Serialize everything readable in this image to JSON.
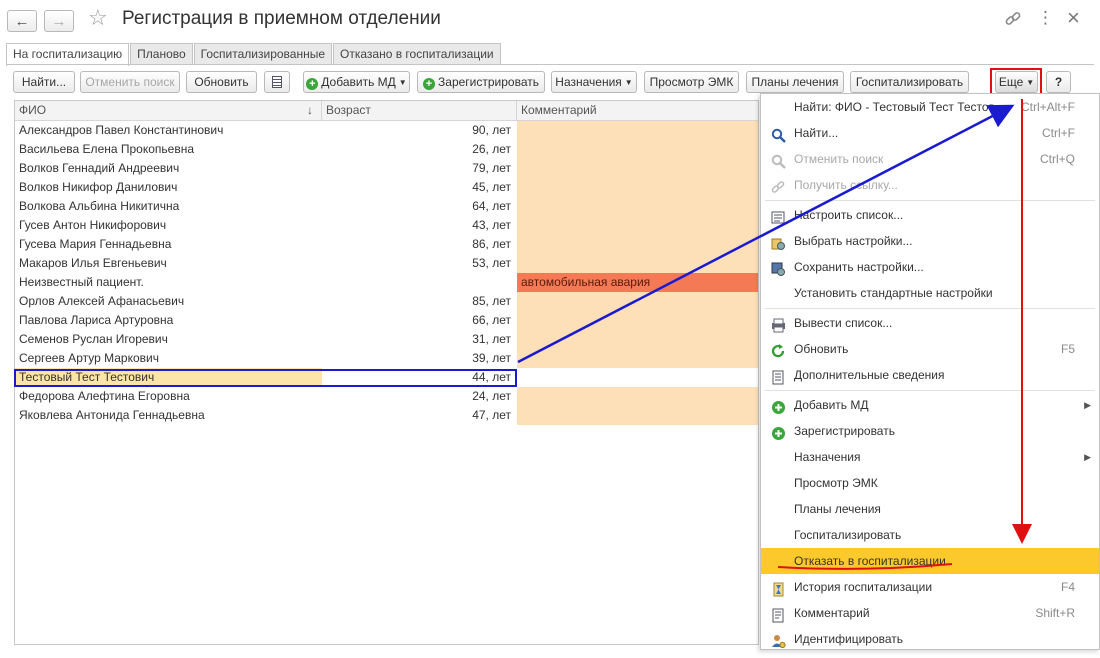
{
  "window": {
    "title": "Регистрация в приемном отделении",
    "back_icon": "←",
    "forward_icon": "→",
    "star_icon": "☆",
    "link_icon": "🔗",
    "more_icon": "⋮",
    "close_icon": "×"
  },
  "tabs": [
    {
      "label": "На госпитализацию",
      "active": true
    },
    {
      "label": "Планово"
    },
    {
      "label": "Госпитализированные"
    },
    {
      "label": "Отказано в госпитализации"
    }
  ],
  "toolbar": {
    "find": "Найти...",
    "cancel_search": "Отменить поиск",
    "refresh": "Обновить",
    "add_md": "Добавить МД",
    "register": "Зарегистрировать",
    "assignments": "Назначения",
    "view_emk": "Просмотр ЭМК",
    "treatment_plans": "Планы лечения",
    "hospitalize": "Госпитализировать",
    "more": "Еще",
    "help": "?"
  },
  "table": {
    "columns": [
      "ФИО",
      "Возраст",
      "Комментарий"
    ],
    "sort_indicator": "↓",
    "rows": [
      {
        "fio": "Александров Павел Константинович",
        "age": "90, лет",
        "comment": ""
      },
      {
        "fio": "Васильева Елена Прокопьевна",
        "age": "26, лет",
        "comment": ""
      },
      {
        "fio": "Волков Геннадий Андреевич",
        "age": "79, лет",
        "comment": ""
      },
      {
        "fio": "Волков Никифор Данилович",
        "age": "45, лет",
        "comment": ""
      },
      {
        "fio": "Волкова Альбина Никитична",
        "age": "64, лет",
        "comment": ""
      },
      {
        "fio": "Гусев Антон Никифорович",
        "age": "43, лет",
        "comment": ""
      },
      {
        "fio": "Гусева Мария Геннадьевна",
        "age": "86, лет",
        "comment": ""
      },
      {
        "fio": "Макаров Илья Евгеньевич",
        "age": "53, лет",
        "comment": ""
      },
      {
        "fio": "Неизвестный пациент.",
        "age": "",
        "comment": "автомобильная авария"
      },
      {
        "fio": "Орлов Алексей Афанасьевич",
        "age": "85, лет",
        "comment": ""
      },
      {
        "fio": "Павлова Лариса Артуровна",
        "age": "66, лет",
        "comment": ""
      },
      {
        "fio": "Семенов Руслан Игоревич",
        "age": "31, лет",
        "comment": ""
      },
      {
        "fio": "Сергеев Артур Маркович",
        "age": "39, лет",
        "comment": ""
      },
      {
        "fio": "Тестовый Тест Тестович",
        "age": "44, лет",
        "comment": "",
        "selected": true
      },
      {
        "fio": "Федорова Алефтина Егоровна",
        "age": "24, лет",
        "comment": ""
      },
      {
        "fio": "Яковлева Антонида Геннадьевна",
        "age": "47, лет",
        "comment": ""
      }
    ]
  },
  "menu": {
    "items": [
      {
        "label": "Найти: ФИО - Тестовый Тест Тестов...",
        "shortcut": "Ctrl+Alt+F",
        "icon": "none"
      },
      {
        "label": "Найти...",
        "shortcut": "Ctrl+F",
        "icon": "search-icon"
      },
      {
        "label": "Отменить поиск",
        "shortcut": "Ctrl+Q",
        "icon": "cancel-search-icon",
        "disabled": true
      },
      {
        "label": "Получить ссылку...",
        "shortcut": "",
        "icon": "link-icon",
        "disabled": true
      },
      {
        "label": "Настроить список...",
        "shortcut": "",
        "icon": "list-settings-icon"
      },
      {
        "label": "Выбрать настройки...",
        "shortcut": "",
        "icon": "choose-settings-icon"
      },
      {
        "label": "Сохранить настройки...",
        "shortcut": "",
        "icon": "save-settings-icon"
      },
      {
        "label": "Установить стандартные настройки",
        "shortcut": "",
        "icon": "none"
      },
      {
        "label": "Вывести список...",
        "shortcut": "",
        "icon": "print-list-icon"
      },
      {
        "label": "Обновить",
        "shortcut": "F5",
        "icon": "refresh-icon"
      },
      {
        "label": "Дополнительные сведения",
        "shortcut": "",
        "icon": "info-icon"
      },
      {
        "label": "Добавить МД",
        "shortcut": "",
        "icon": "add-icon",
        "submenu": true
      },
      {
        "label": "Зарегистрировать",
        "shortcut": "",
        "icon": "add-icon"
      },
      {
        "label": "Назначения",
        "shortcut": "",
        "icon": "none",
        "submenu": true
      },
      {
        "label": "Просмотр ЭМК",
        "shortcut": "",
        "icon": "none"
      },
      {
        "label": "Планы лечения",
        "shortcut": "",
        "icon": "none"
      },
      {
        "label": "Госпитализировать",
        "shortcut": "",
        "icon": "none"
      },
      {
        "label": "Отказать в госпитализации",
        "shortcut": "",
        "icon": "none",
        "highlighted": true
      },
      {
        "label": "История госпитализации",
        "shortcut": "F4",
        "icon": "history-icon"
      },
      {
        "label": "Комментарий",
        "shortcut": "Shift+R",
        "icon": "comment-icon"
      },
      {
        "label": "Идентифицировать",
        "shortcut": "",
        "icon": "identify-icon"
      }
    ],
    "submenu_glyph": "▶"
  },
  "colors": {
    "comment_bg": "#fde0b8",
    "accident_bg": "#f47a55",
    "highlight": "#fbc92c",
    "annotation_blue": "#1a1ad0",
    "annotation_red": "#e01010"
  }
}
